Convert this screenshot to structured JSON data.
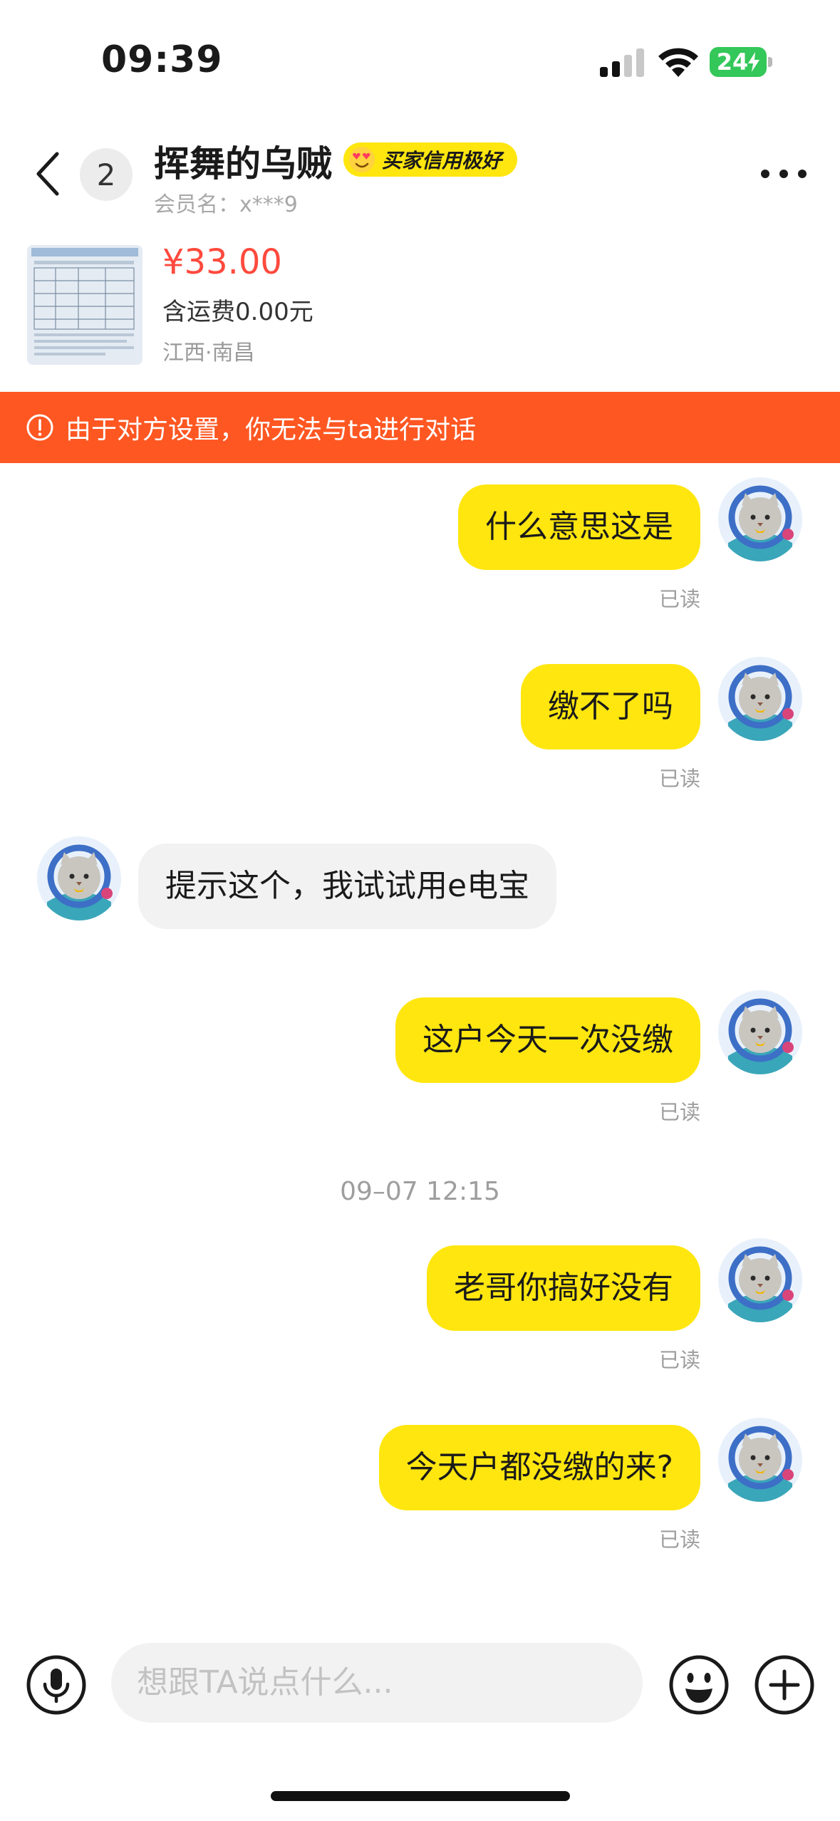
{
  "status_bar": {
    "time": "09:39",
    "battery": "24",
    "battery_color": "#34c759"
  },
  "header": {
    "back_icon": "chevron-left-icon",
    "unread_count": "2",
    "seller_name": "挥舞的乌贼",
    "credit_badge": "买家信用极好",
    "member_label": "会员名：x***9",
    "more_icon": "more-dots-icon"
  },
  "product": {
    "price": "¥33.00",
    "shipping": "含运费0.00元",
    "location": "江西·南昌",
    "price_color": "#ff4a3d"
  },
  "banner": {
    "icon": "alert-circle-icon",
    "text": "由于对方设置，你无法与ta进行对话",
    "color": "#ff5722"
  },
  "messages": [
    {
      "side": "mine",
      "text": "什么意思这是",
      "status": "已读"
    },
    {
      "side": "mine",
      "text": "缴不了吗",
      "status": "已读"
    },
    {
      "side": "theirs",
      "text": "提示这个，我试试用e电宝"
    },
    {
      "side": "mine",
      "text": "这户今天一次没缴",
      "status": "已读"
    },
    {
      "side": "divider",
      "text": "09–07 12:15"
    },
    {
      "side": "mine",
      "text": "老哥你搞好没有",
      "status": "已读"
    },
    {
      "side": "mine",
      "text": "今天户都没缴的来?",
      "status": "已读"
    }
  ],
  "input_bar": {
    "voice_icon": "microphone-icon",
    "placeholder": "想跟TA说点什么...",
    "emoji_icon": "emoji-icon",
    "plus_icon": "plus-icon"
  },
  "colors": {
    "my_bubble": "#ffe60f",
    "their_bubble": "#f2f2f2"
  }
}
